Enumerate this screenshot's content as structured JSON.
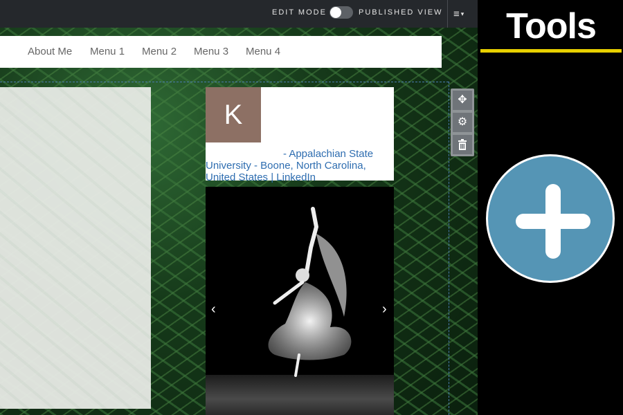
{
  "topbar": {
    "edit_mode_label": "EDIT MODE",
    "published_view_label": "PUBLISHED VIEW",
    "menu_icon": "hamburger-icon"
  },
  "nav": {
    "items": [
      "About Me",
      "Menu 1",
      "Menu 2",
      "Menu 3",
      "Menu 4"
    ]
  },
  "profile": {
    "avatar_letter": "K",
    "line1": "- Appalachian State",
    "line2": "University - Boone, North Carolina,",
    "line3": "United States | LinkedIn"
  },
  "carousel": {
    "prev_icon": "chevron-left-icon",
    "next_icon": "chevron-right-icon"
  },
  "block_tools": {
    "move_icon": "move-icon",
    "settings_icon": "gear-icon",
    "delete_icon": "trash-icon"
  },
  "tools_panel": {
    "title": "Tools",
    "accent_color": "#e8d000",
    "add_button_color": "#5595b5",
    "add_icon": "plus-icon"
  }
}
